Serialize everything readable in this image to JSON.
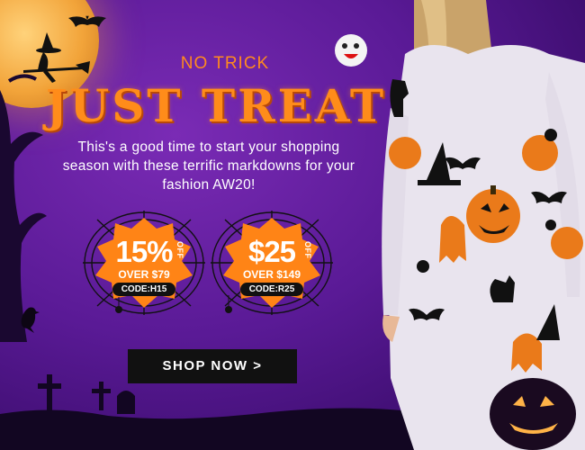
{
  "promo": {
    "tagline": "NO TRICK",
    "headline": "JUST TREAT",
    "body": "This's a good time to start your shopping season with these terrific markdowns for your fashion AW20!"
  },
  "coupons": [
    {
      "amount": "15%",
      "off": "OFF",
      "condition": "OVER $79",
      "code": "CODE:H15"
    },
    {
      "amount": "$25",
      "off": "OFF",
      "condition": "OVER $149",
      "code": "CODE:R25"
    }
  ],
  "cta": {
    "label": "SHOP NOW >"
  },
  "colors": {
    "background": "#5a1a96",
    "accent_orange": "#ff8c1a",
    "button": "#111111",
    "dress": "#e9e4ee"
  },
  "decor": {
    "icons": [
      "moon-icon",
      "witch-icon",
      "bat-icon",
      "ghost-icon",
      "pumpkin-icon",
      "spider-web-icon",
      "tombstone-icon",
      "skull-icon",
      "black-cat-icon",
      "crow-icon"
    ]
  }
}
